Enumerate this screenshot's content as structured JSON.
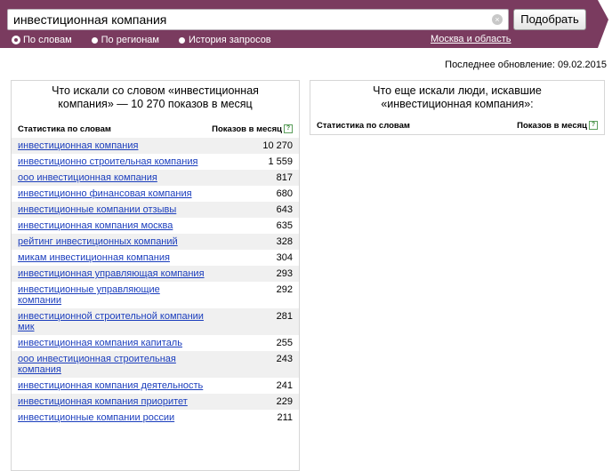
{
  "search": {
    "query": "инвестиционная компания",
    "submit_label": "Подобрать",
    "clear_symbol": "×"
  },
  "modes": [
    {
      "label": "По словам",
      "selected": true
    },
    {
      "label": "По регионам",
      "selected": false
    },
    {
      "label": "История запросов",
      "selected": false
    }
  ],
  "region_label": "Москва и область",
  "updated_text": "Последнее обновление: 09.02.2015",
  "left_panel": {
    "title": "Что искали со словом «инвестиционная компания» — 10 270 показов в месяц",
    "col_phrase": "Статистика по словам",
    "col_count": "Показов в месяц",
    "help_symbol": "?",
    "rows": [
      {
        "phrase": "инвестиционная компания",
        "count": "10 270"
      },
      {
        "phrase": "инвестиционно строительная компания",
        "count": "1 559"
      },
      {
        "phrase": "ооо инвестиционная компания",
        "count": "817"
      },
      {
        "phrase": "инвестиционно финансовая компания",
        "count": "680"
      },
      {
        "phrase": "инвестиционные компании отзывы",
        "count": "643"
      },
      {
        "phrase": "инвестиционная компания москва",
        "count": "635"
      },
      {
        "phrase": "рейтинг инвестиционных компаний",
        "count": "328"
      },
      {
        "phrase": "микам инвестиционная компания",
        "count": "304"
      },
      {
        "phrase": "инвестиционная управляющая компания",
        "count": "293"
      },
      {
        "phrase": "инвестиционные управляющие компании",
        "count": "292"
      },
      {
        "phrase": "инвестиционной строительной компании мик",
        "count": "281"
      },
      {
        "phrase": "инвестиционная компания капиталь",
        "count": "255"
      },
      {
        "phrase": "ооо инвестиционная строительная компания",
        "count": "243"
      },
      {
        "phrase": "инвестиционная компания деятельность",
        "count": "241"
      },
      {
        "phrase": "инвестиционная компания приоритет",
        "count": "229"
      },
      {
        "phrase": "инвестиционные компании россии",
        "count": "211"
      }
    ]
  },
  "right_panel": {
    "title": "Что еще искали люди, искавшие «инвестиционная компания»:",
    "col_phrase": "Статистика по словам",
    "col_count": "Показов в месяц",
    "help_symbol": "?"
  },
  "colors": {
    "bar": "#7a3b5f",
    "link": "#1a3dbd",
    "row_alt": "#f0f0f0"
  }
}
